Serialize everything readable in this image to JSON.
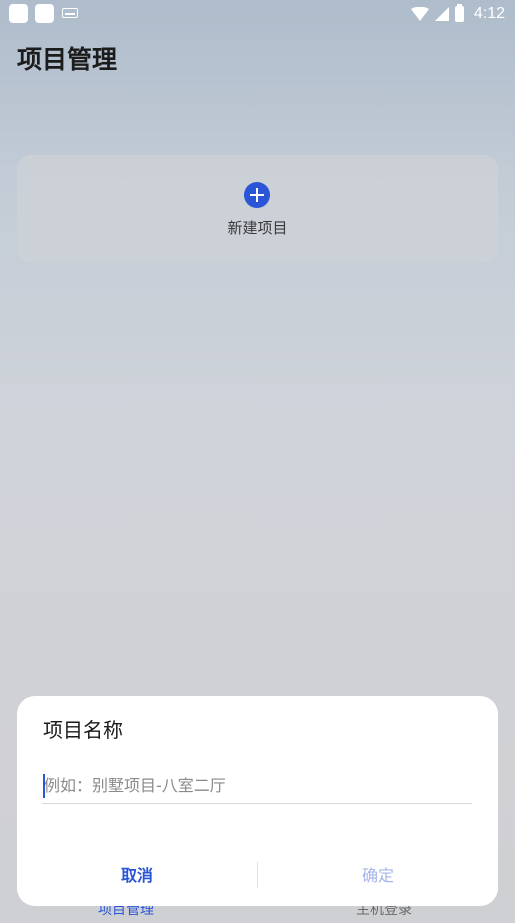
{
  "status_bar": {
    "time": "4:12",
    "icons": [
      "app-square-icon",
      "app-square-icon",
      "keyboard-icon",
      "wifi-icon",
      "signal-icon",
      "battery-icon"
    ]
  },
  "header": {
    "title": "项目管理"
  },
  "new_project_card": {
    "label": "新建项目",
    "icon": "plus-circle-icon",
    "accent": "#2a55d6"
  },
  "bottom_nav": {
    "items": [
      {
        "label": "项目管理",
        "active": true
      },
      {
        "label": "主机登录",
        "active": false
      }
    ]
  },
  "dialog": {
    "title": "项目名称",
    "input": {
      "placeholder": "例如：别墅项目-八室二厅",
      "value": ""
    },
    "cancel_label": "取消",
    "confirm_label": "确定"
  },
  "colors": {
    "accent": "#2a55d6",
    "disabled": "#a4b5ea"
  }
}
